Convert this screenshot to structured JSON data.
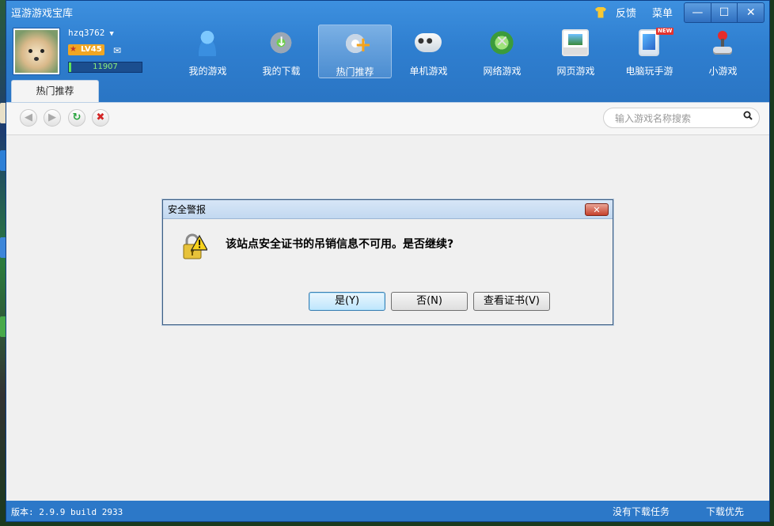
{
  "app": {
    "title": "逗游游戏宝库",
    "feedback": "反馈",
    "menu": "菜单",
    "win_min": "—",
    "win_max": "☐",
    "win_close": "✕"
  },
  "user": {
    "name": "hzq3762",
    "caret": "▼",
    "level": "LV45",
    "points": "11907",
    "mail": "✉"
  },
  "nav": [
    {
      "label": "我的游戏",
      "icon": "my-games-icon"
    },
    {
      "label": "我的下载",
      "icon": "download-gear-icon"
    },
    {
      "label": "热门推荐",
      "icon": "hot-recommend-icon"
    },
    {
      "label": "单机游戏",
      "icon": "gamepad-icon"
    },
    {
      "label": "网络游戏",
      "icon": "online-games-icon"
    },
    {
      "label": "网页游戏",
      "icon": "web-games-icon"
    },
    {
      "label": "电脑玩手游",
      "icon": "phone-games-icon",
      "badge": "NEW"
    },
    {
      "label": "小游戏",
      "icon": "joystick-icon"
    }
  ],
  "active_tab": "热门推荐",
  "toolbar": {
    "back": "◀",
    "forward": "▶",
    "refresh": "↻",
    "stop": "✖",
    "search_placeholder": "输入游戏名称搜索"
  },
  "dialog": {
    "title": "安全警报",
    "close": "✕",
    "message": "该站点安全证书的吊销信息不可用。是否继续?",
    "yes": "是(Y)",
    "no": "否(N)",
    "view_cert": "查看证书(V)"
  },
  "status": {
    "version": "版本: 2.9.9 build 2933",
    "no_task": "没有下载任务",
    "download_first": "下载优先"
  }
}
